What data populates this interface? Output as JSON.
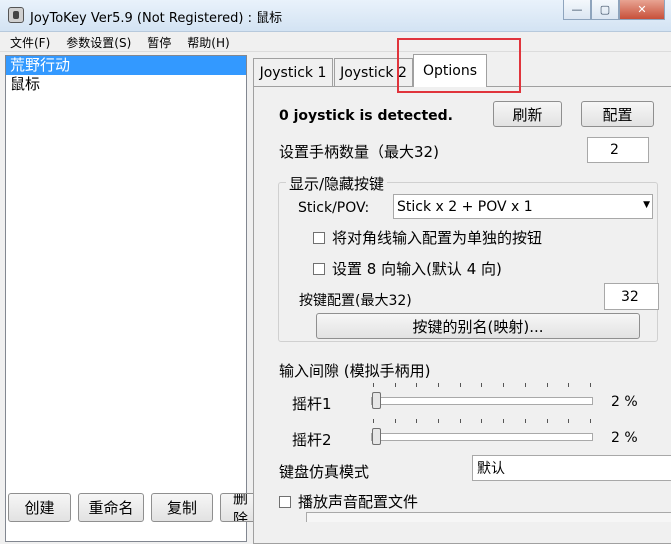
{
  "window": {
    "title": "JoyToKey Ver5.9 (Not Registered) : 鼠标",
    "controls": {
      "minimize": "—",
      "maximize": "▢",
      "close": "✕"
    }
  },
  "menu": [
    "文件(F)",
    "参数设置(S)",
    "暂停",
    "帮助(H)"
  ],
  "configs": {
    "items": [
      "荒野行动",
      "鼠标"
    ],
    "selected_index": 0
  },
  "left_buttons": [
    "创建",
    "重命名",
    "复制",
    "删除"
  ],
  "tabs": [
    "Joystick 1",
    "Joystick 2",
    "Options"
  ],
  "active_tab": "Options",
  "options": {
    "detected": "0 joystick is detected.",
    "refresh_button": "刷新",
    "config_button": "配置",
    "joystick_count_label": "设置手柄数量（最大32)",
    "joystick_count_value": "2",
    "group_title": "显示/隐藏按键",
    "stick_pov_label": "Stick/POV:",
    "stick_pov_value": "Stick x 2 + POV x 1",
    "diag_checkbox": "将对角线输入配置为单独的按钮",
    "diag_checked": false,
    "eight_dir_checkbox": "设置 8 向输入(默认 4 向)",
    "eight_dir_checked": false,
    "button_config_label": "按键配置(最大32)",
    "button_config_value": "32",
    "alias_button": "按键的别名(映射)...",
    "input_interval_label": "输入间隙 (模拟手柄用)",
    "stick1_label": "摇杆1",
    "stick1_value": "2 %",
    "stick1_level": 0.02,
    "stick2_label": "摇杆2",
    "stick2_value": "2 %",
    "stick2_level": 0.02,
    "keyboard_mode_label": "键盘仿真模式",
    "keyboard_mode_value": "默认",
    "play_sound_checkbox": "播放声音配置文件",
    "play_sound_checked": false
  },
  "colors": {
    "selection": "#3399ff",
    "annotation_box": "#e0343c",
    "window_bg": "#f0f0f0"
  }
}
